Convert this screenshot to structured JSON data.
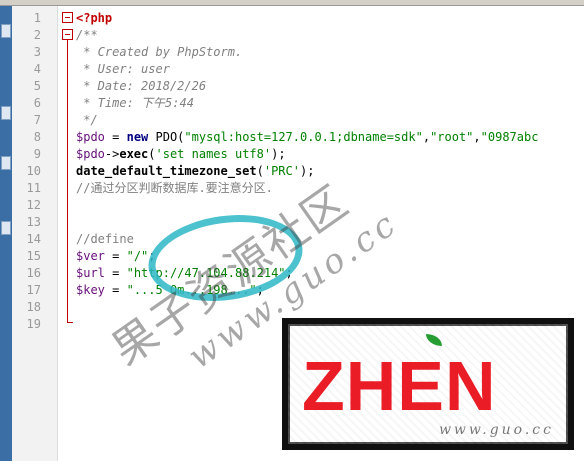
{
  "editor": {
    "lines": [
      {
        "n": "1",
        "parts": [
          {
            "c": "tag",
            "t": "<?php"
          }
        ]
      },
      {
        "n": "2",
        "parts": [
          {
            "c": "doc",
            "t": "/**"
          }
        ]
      },
      {
        "n": "3",
        "parts": [
          {
            "c": "doc",
            "t": " * Created by PhpStorm."
          }
        ]
      },
      {
        "n": "4",
        "parts": [
          {
            "c": "doc",
            "t": " * User: user"
          }
        ]
      },
      {
        "n": "5",
        "parts": [
          {
            "c": "doc",
            "t": " * Date: 2018/2/26"
          }
        ]
      },
      {
        "n": "6",
        "parts": [
          {
            "c": "doc",
            "t": " * Time: 下午5:44"
          }
        ]
      },
      {
        "n": "7",
        "parts": [
          {
            "c": "doc",
            "t": " */"
          }
        ]
      },
      {
        "n": "8",
        "parts": [
          {
            "c": "var",
            "t": "$pdo"
          },
          {
            "c": "plain",
            "t": " = "
          },
          {
            "c": "kw",
            "t": "new "
          },
          {
            "c": "plain",
            "t": "PDO("
          },
          {
            "c": "str",
            "t": "\"mysql:host=127.0.0.1;dbname=sdk\""
          },
          {
            "c": "plain",
            "t": ","
          },
          {
            "c": "str",
            "t": "\"root\""
          },
          {
            "c": "plain",
            "t": ","
          },
          {
            "c": "str",
            "t": "\"0987abc"
          }
        ]
      },
      {
        "n": "9",
        "parts": [
          {
            "c": "var",
            "t": "$pdo"
          },
          {
            "c": "plain",
            "t": "->"
          },
          {
            "c": "fn",
            "t": "exec"
          },
          {
            "c": "plain",
            "t": "("
          },
          {
            "c": "str",
            "t": "'set names utf8'"
          },
          {
            "c": "plain",
            "t": ");"
          }
        ]
      },
      {
        "n": "10",
        "parts": [
          {
            "c": "fn",
            "t": "date_default_timezone_set"
          },
          {
            "c": "plain",
            "t": "("
          },
          {
            "c": "str",
            "t": "'PRC'"
          },
          {
            "c": "plain",
            "t": ");"
          }
        ]
      },
      {
        "n": "11",
        "parts": [
          {
            "c": "cmt",
            "t": "//通过分区判断数据库.要注意分区."
          }
        ]
      },
      {
        "n": "12",
        "parts": []
      },
      {
        "n": "13",
        "parts": []
      },
      {
        "n": "14",
        "parts": [
          {
            "c": "cmt",
            "t": "//define"
          }
        ]
      },
      {
        "n": "15",
        "parts": [
          {
            "c": "var",
            "t": "$ver"
          },
          {
            "c": "plain",
            "t": " = "
          },
          {
            "c": "str",
            "t": "\"/\""
          },
          {
            "c": "plain",
            "t": ";"
          }
        ]
      },
      {
        "n": "16",
        "parts": [
          {
            "c": "var",
            "t": "$url"
          },
          {
            "c": "plain",
            "t": " = "
          },
          {
            "c": "str",
            "t": "\"http://47.104.88.214\""
          },
          {
            "c": "plain",
            "t": ";"
          }
        ]
      },
      {
        "n": "17",
        "parts": [
          {
            "c": "var",
            "t": "$key"
          },
          {
            "c": "plain",
            "t": " = "
          },
          {
            "c": "str",
            "t": "\"...5 Qm...198...\""
          },
          {
            "c": "plain",
            "t": ";"
          }
        ]
      },
      {
        "n": "18",
        "parts": []
      },
      {
        "n": "19",
        "parts": []
      }
    ]
  },
  "watermark": {
    "text_cn": "果子资源社区",
    "text_url": "www.guo.cc"
  },
  "stamp": {
    "logo_text": "ZHEN",
    "site": "www.guo.cc"
  },
  "colors": {
    "highlight_ellipse": "#2eb7c7",
    "stamp_red": "#e0262f"
  }
}
